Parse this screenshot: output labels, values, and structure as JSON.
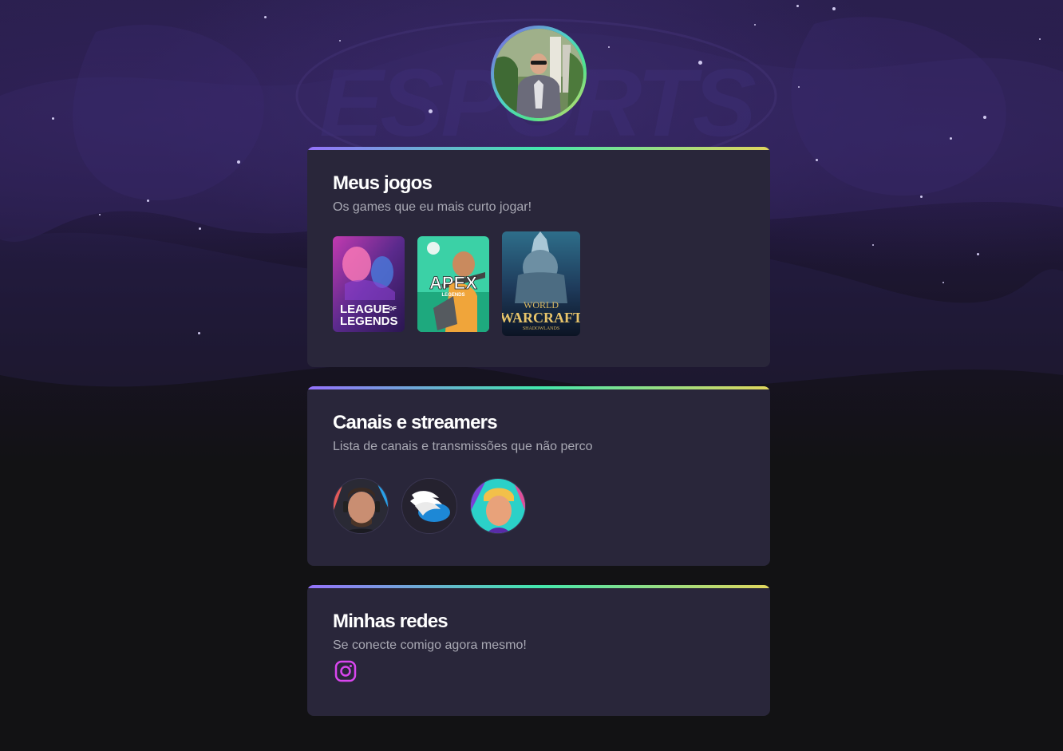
{
  "profile": {
    "avatar_alt": "Foto de perfil"
  },
  "sections": {
    "games": {
      "title": "Meus jogos",
      "subtitle": "Os games que eu mais curto jogar!",
      "items": [
        {
          "name": "League of Legends",
          "line1": "LEAGUE",
          "line1b": "OF",
          "line2": "LEGENDS"
        },
        {
          "name": "Apex Legends",
          "line1": "APEX",
          "line2": "LEGENDS"
        },
        {
          "name": "World of Warcraft Shadowlands",
          "line1": "WORLD",
          "line2": "WARCRAFT",
          "line3": "SHADOWLANDS"
        }
      ]
    },
    "channels": {
      "title": "Canais e streamers",
      "subtitle": "Lista de canais e transmissões que não perco",
      "items": [
        {
          "name": "streamer-1"
        },
        {
          "name": "streamer-2"
        },
        {
          "name": "streamer-3"
        }
      ]
    },
    "social": {
      "title": "Minhas redes",
      "subtitle": "Se conecte comigo agora mesmo!",
      "links": [
        {
          "icon": "instagram-icon",
          "color": "#d946ef"
        }
      ]
    }
  },
  "colors": {
    "card_bg": "#29263a",
    "accent_gradient": [
      "#9572fc",
      "#43e7ad",
      "#e1d55d"
    ],
    "subtitle": "#a8a8b3"
  }
}
